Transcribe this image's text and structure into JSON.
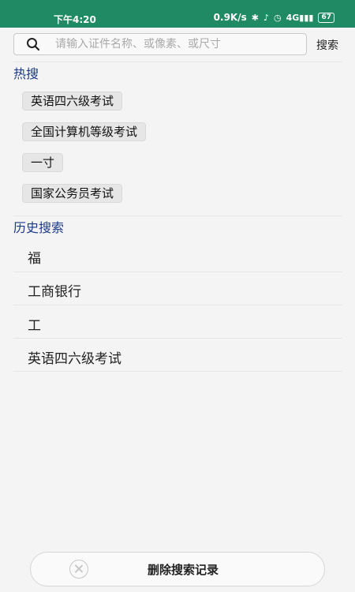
{
  "status_bar": {
    "time": "下午4:20",
    "network_speed": "0.9K/s",
    "signal": "4G",
    "battery": "67"
  },
  "search": {
    "placeholder": "请输入证件名称、或像素、或尺寸",
    "value": "",
    "button_label": "搜索"
  },
  "hot": {
    "title": "热搜",
    "items": [
      "英语四六级考试",
      "全国计算机等级考试",
      "一寸",
      "国家公务员考试"
    ]
  },
  "history": {
    "title": "历史搜索",
    "items": [
      "福",
      "工商银行",
      "工",
      "英语四六级考试"
    ]
  },
  "delete_button": {
    "label": "删除搜索记录"
  }
}
